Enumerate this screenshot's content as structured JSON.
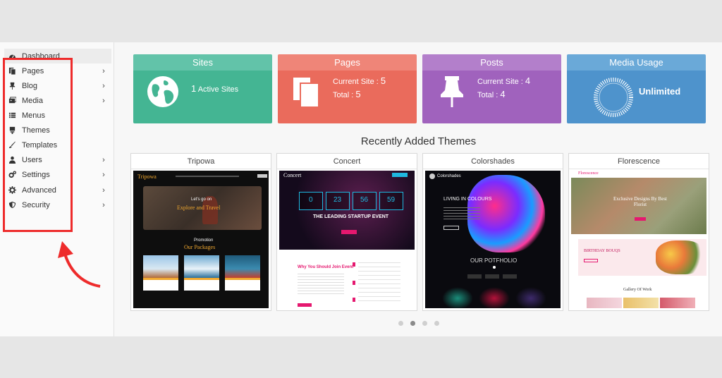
{
  "sidebar": {
    "items": [
      {
        "label": "Dashboard",
        "icon": "dashboard-icon",
        "chevron": false
      },
      {
        "label": "Pages",
        "icon": "pages-icon",
        "chevron": true
      },
      {
        "label": "Blog",
        "icon": "pin-icon",
        "chevron": true
      },
      {
        "label": "Media",
        "icon": "media-icon",
        "chevron": true
      },
      {
        "label": "Menus",
        "icon": "list-icon",
        "chevron": false
      },
      {
        "label": "Themes",
        "icon": "themes-icon",
        "chevron": false
      },
      {
        "label": "Templates",
        "icon": "brush-icon",
        "chevron": false
      },
      {
        "label": "Users",
        "icon": "user-icon",
        "chevron": true
      },
      {
        "label": "Settings",
        "icon": "cogs-icon",
        "chevron": true
      },
      {
        "label": "Advanced",
        "icon": "gear-icon",
        "chevron": true
      },
      {
        "label": "Security",
        "icon": "shield-icon",
        "chevron": true
      }
    ],
    "chevron_glyph": "›"
  },
  "cards": {
    "sites": {
      "title": "Sites",
      "value": "1",
      "text": "Active Sites",
      "head_color": "#62c3a9",
      "body_color": "#44b593"
    },
    "pages": {
      "title": "Pages",
      "line1_label": "Current Site :",
      "line1_value": "5",
      "line2_label": "Total :",
      "line2_value": "5",
      "head_color": "#ef8578",
      "body_color": "#ea6b5c"
    },
    "posts": {
      "title": "Posts",
      "line1_label": "Current Site :",
      "line1_value": "4",
      "line2_label": "Total :",
      "line2_value": "4",
      "head_color": "#b37fcb",
      "body_color": "#a062bd"
    },
    "media": {
      "title": "Media Usage",
      "value": "Unlimited",
      "head_color": "#6aa9d8",
      "body_color": "#4e93cc"
    }
  },
  "section_title": "Recently Added Themes",
  "themes": [
    {
      "name": "Tripowa"
    },
    {
      "name": "Concert"
    },
    {
      "name": "Colorshades"
    },
    {
      "name": "Florescence"
    }
  ],
  "previews": {
    "tripowa": {
      "logo": "Tripowa",
      "hero_small": "Let's go on",
      "hero_big": "Explore and Travel",
      "pkg_small": "Promotion",
      "pkg_big": "Our Packages"
    },
    "concert": {
      "logo": "Concert",
      "count": [
        "0",
        "23",
        "56",
        "59"
      ],
      "headline": "THE LEADING STARTUP EVENT",
      "sub": "Why You Should Join Event"
    },
    "colorshades": {
      "brand": "Colorshades",
      "hero": "LIVING IN COLOURS",
      "portfolio": "OUR POTFHOLIO"
    },
    "florescence": {
      "logo": "Florescence",
      "hero": "Exclusive Designs By Best Florist",
      "sub": "BIRTHDAY BOUQS",
      "gallery": "Gallery Of Work"
    }
  },
  "carousel": {
    "count": 4,
    "active": 2
  },
  "colors": {
    "highlight": "#ee2b2b",
    "accent_pink": "#e5186f",
    "cyan": "#1fb8e0"
  }
}
